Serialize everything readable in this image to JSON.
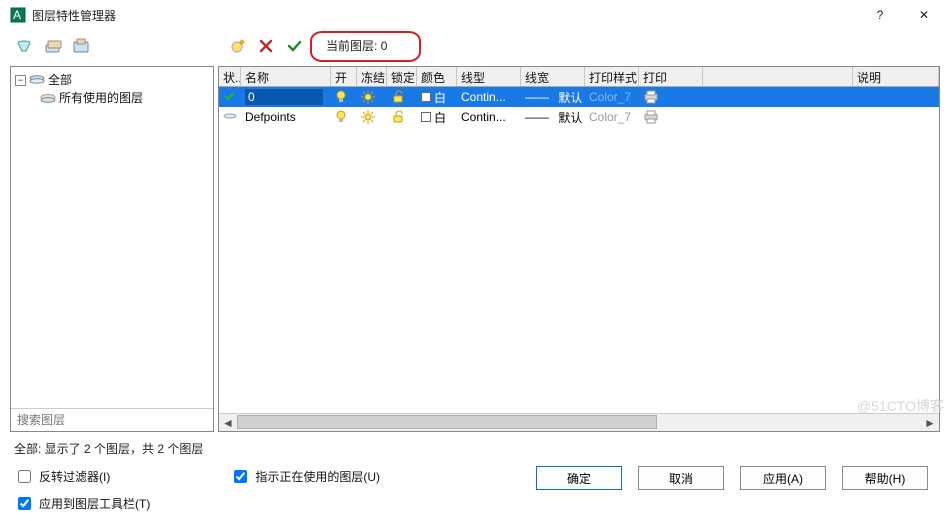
{
  "titlebar": {
    "title": "图层特性管理器",
    "help": "?",
    "close": "✕"
  },
  "toolbar": {
    "current_layer_label": "当前图层:",
    "current_layer_value": "0"
  },
  "tree": {
    "root": "全部",
    "child": "所有使用的图层",
    "search_placeholder": "搜索图层"
  },
  "columns": {
    "state": "状..",
    "name": "名称",
    "on": "开",
    "freeze": "冻结",
    "lock": "锁定",
    "color": "颜色",
    "linetype": "线型",
    "lineweight": "线宽",
    "plotstyle": "打印样式",
    "plot": "打印",
    "desc": "说明"
  },
  "rows": [
    {
      "name": "0",
      "color_name": "白",
      "linetype": "Contin...",
      "lw_dash": "——",
      "lw": "默认",
      "plotstyle": "Color_7",
      "selected": true
    },
    {
      "name": "Defpoints",
      "color_name": "白",
      "linetype": "Contin...",
      "lw_dash": "——",
      "lw": "默认",
      "plotstyle": "Color_7",
      "selected": false
    }
  ],
  "status": "全部: 显示了 2 个图层，共 2 个图层",
  "opts": {
    "invert": "反转过滤器(I)",
    "indicate": "指示正在使用的图层(U)",
    "apply_toolbar": "应用到图层工具栏(T)"
  },
  "buttons": {
    "ok": "确定",
    "cancel": "取消",
    "apply": "应用(A)",
    "help": "帮助(H)"
  },
  "watermark": "@51CTO博客"
}
